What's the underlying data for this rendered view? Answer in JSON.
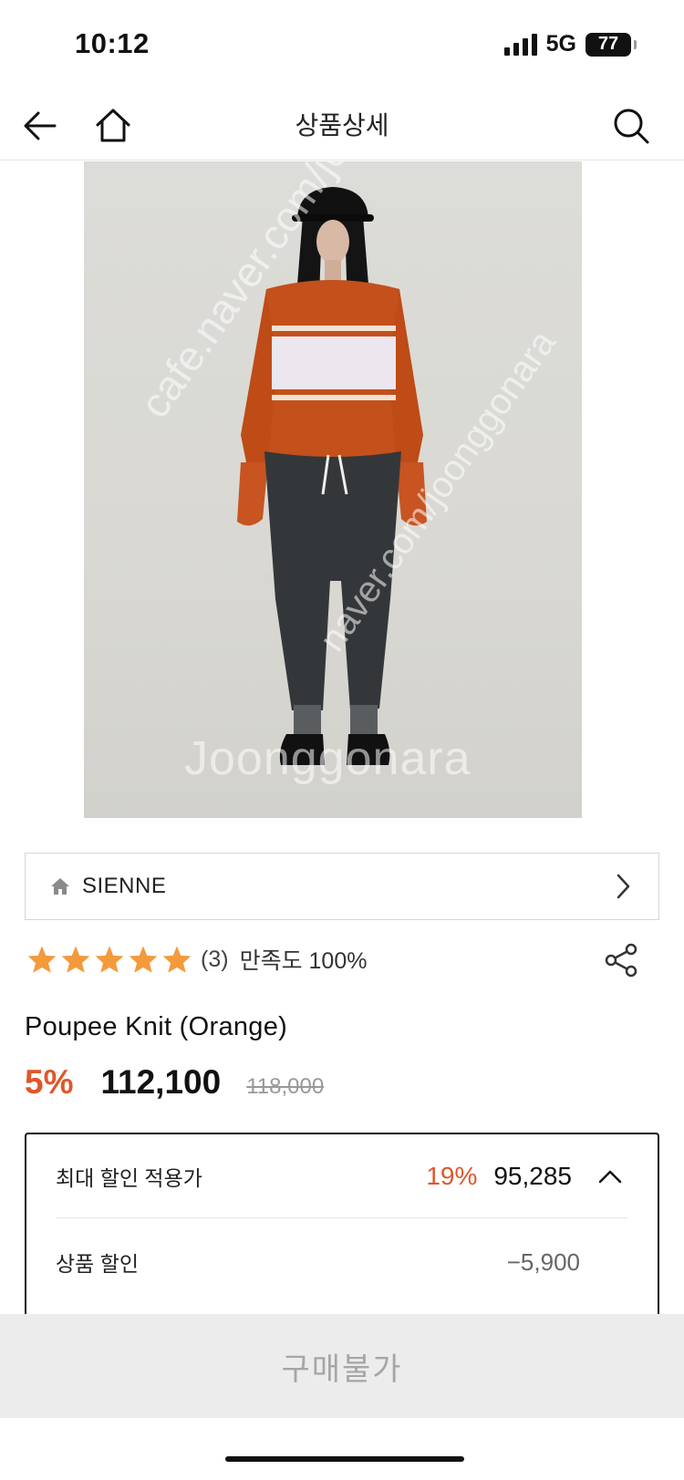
{
  "status_bar": {
    "time": "10:12",
    "network": "5G",
    "battery": "77"
  },
  "nav": {
    "title": "상품상세"
  },
  "image": {
    "watermark_main": "Joonggonara",
    "watermark_diagonal_1": "cafe.naver.com/joonggo",
    "watermark_diagonal_2": "naver.com/joonggonara"
  },
  "brand": {
    "name": "SIENNE"
  },
  "rating": {
    "stars": 5,
    "count": "(3)",
    "satisfaction": "만족도 100%"
  },
  "product": {
    "name": "Poupee Knit (Orange)"
  },
  "price": {
    "discount_rate": "5%",
    "sale_price": "112,100",
    "original_price": "118,000"
  },
  "discount_box": {
    "label": "최대 할인 적용가",
    "rate": "19%",
    "price": "95,285",
    "item_label": "상품 할인",
    "item_value": "−5,900"
  },
  "buy_bar": {
    "label": "구매불가"
  },
  "colors": {
    "accent": "#e0562b",
    "star": "#f39a3c"
  }
}
